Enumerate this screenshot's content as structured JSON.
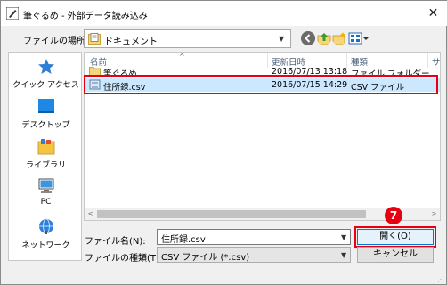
{
  "window": {
    "title": "筆ぐるめ - 外部データ読み込み",
    "close_glyph": "✕"
  },
  "toolbar": {
    "location_label": "ファイルの場所(I):",
    "location_value": "ドキュメント"
  },
  "sidebar": {
    "items": [
      {
        "label": "クイック アクセス",
        "icon": "star-icon"
      },
      {
        "label": "デスクトップ",
        "icon": "desktop-icon"
      },
      {
        "label": "ライブラリ",
        "icon": "library-icon"
      },
      {
        "label": "PC",
        "icon": "pc-icon"
      },
      {
        "label": "ネットワーク",
        "icon": "network-icon"
      }
    ]
  },
  "filelist": {
    "columns": [
      "名前",
      "更新日時",
      "種類",
      "サ"
    ],
    "sort_glyph": "^",
    "rows": [
      {
        "name": "筆ぐるめ",
        "date": "2016/07/13 13:18",
        "type": "ファイル フォルダー",
        "icon": "folder-icon"
      },
      {
        "name": "住所録.csv",
        "date": "2016/07/15 14:29",
        "type": "CSV ファイル",
        "icon": "csv-file-icon"
      }
    ]
  },
  "scroll": {
    "left": "<",
    "right": ">"
  },
  "fields": {
    "filename_label": "ファイル名(N):",
    "filename_value": "住所録.csv",
    "filetype_label": "ファイルの種類(T):",
    "filetype_value": "CSV ファイル (*.csv)"
  },
  "buttons": {
    "open": "開く(O)",
    "cancel": "キャンセル"
  },
  "annotation": {
    "step": "7"
  },
  "colors": {
    "highlight": "#e60012",
    "selection": "#cce8ff",
    "accent": "#0078d7"
  }
}
